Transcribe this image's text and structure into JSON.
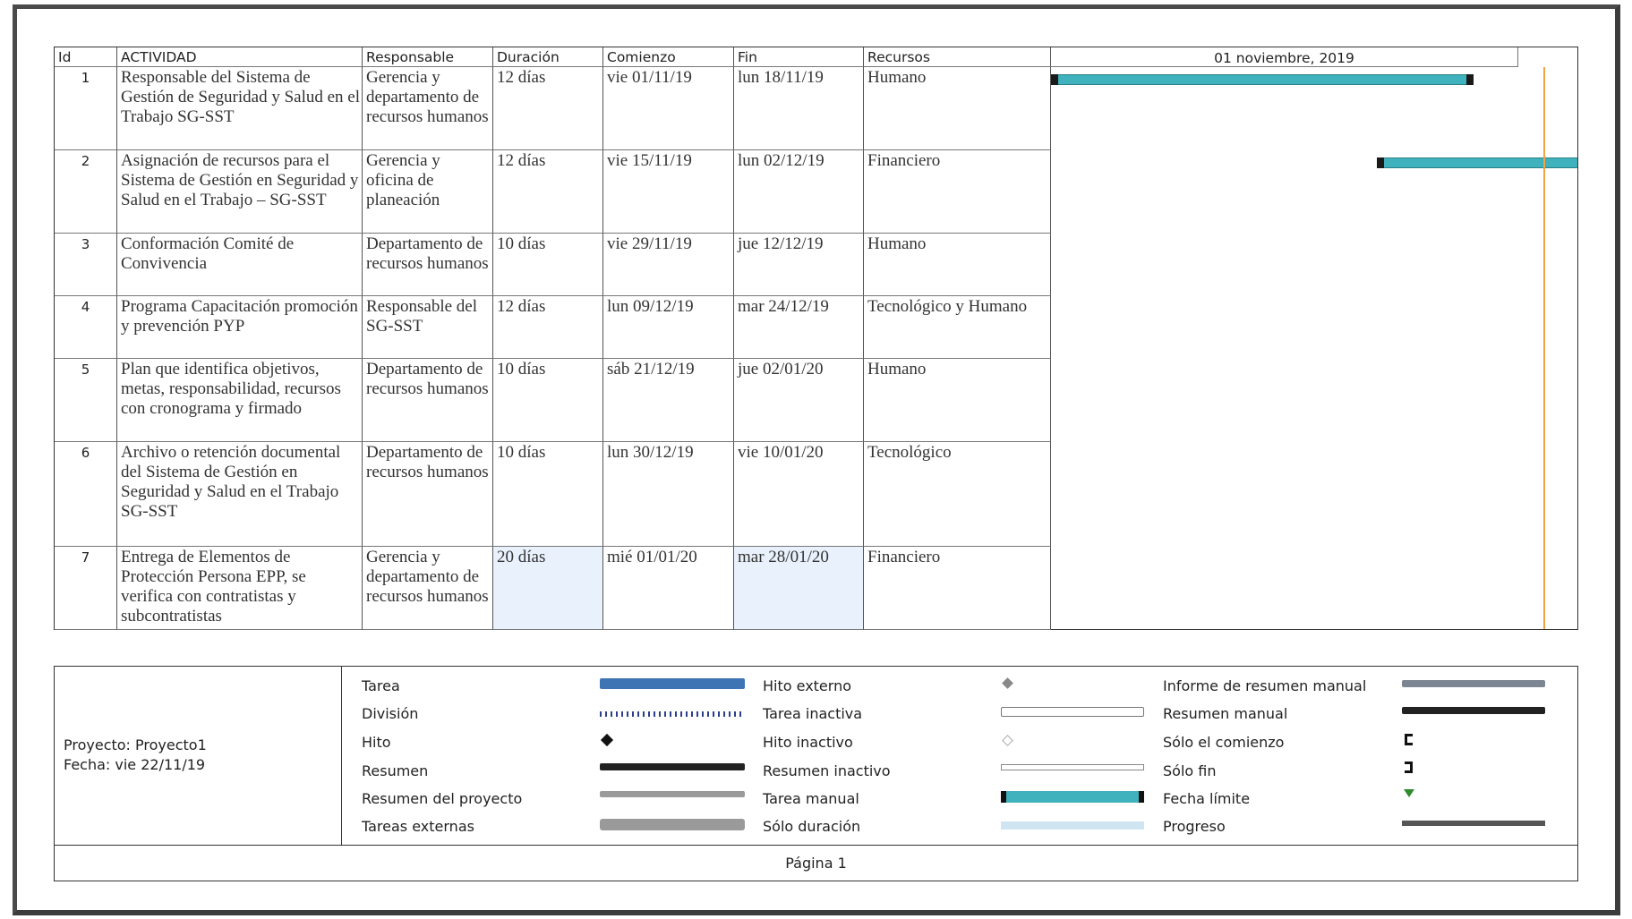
{
  "headers": {
    "id": "Id",
    "actividad": "ACTIVIDAD",
    "responsable": "Responsable",
    "duracion": "Duración",
    "comienzo": "Comienzo",
    "fin": "Fin",
    "recursos": "Recursos",
    "gantt_date": "01 noviembre, 2019"
  },
  "tasks": [
    {
      "id": "1",
      "actividad": "Responsable del Sistema de Gestión de Seguridad y Salud en el Trabajo SG-SST",
      "responsable": "Gerencia y departamento de recursos humanos",
      "duracion": "12 días",
      "comienzo": "vie 01/11/19",
      "fin": "lun 18/11/19",
      "recursos": "Humano"
    },
    {
      "id": "2",
      "actividad": "Asignación de recursos para el Sistema de Gestión en Seguridad y Salud en el Trabajo – SG-SST",
      "responsable": "Gerencia y oficina de planeación",
      "duracion": "12 días",
      "comienzo": "vie 15/11/19",
      "fin": "lun 02/12/19",
      "recursos": "Financiero"
    },
    {
      "id": "3",
      "actividad": "Conformación Comité de Convivencia",
      "responsable": "Departamento de recursos humanos",
      "duracion": "10 días",
      "comienzo": "vie 29/11/19",
      "fin": "jue 12/12/19",
      "recursos": "Humano"
    },
    {
      "id": "4",
      "actividad": "Programa Capacitación promoción y prevención PYP",
      "responsable": "Responsable del SG-SST",
      "duracion": "12 días",
      "comienzo": "lun 09/12/19",
      "fin": "mar 24/12/19",
      "recursos": "Tecnológico y Humano"
    },
    {
      "id": "5",
      "actividad": "Plan que identifica objetivos, metas, responsabilidad, recursos con cronograma y firmado",
      "responsable": "Departamento de recursos humanos",
      "duracion": "10 días",
      "comienzo": "sáb 21/12/19",
      "fin": "jue 02/01/20",
      "recursos": "Humano"
    },
    {
      "id": "6",
      "actividad": "Archivo o retención documental del Sistema de Gestión en Seguridad y Salud en el Trabajo SG-SST",
      "responsable": "Departamento de recursos humanos",
      "duracion": "10 días",
      "comienzo": "lun 30/12/19",
      "fin": "vie 10/01/20",
      "recursos": "Tecnológico"
    },
    {
      "id": "7",
      "actividad": "Entrega de Elementos de Protección Persona EPP, se verifica con contratistas y subcontratistas",
      "responsable": "Gerencia y departamento de recursos humanos",
      "duracion": "20 días",
      "comienzo": "mié 01/01/20",
      "fin": "mar 28/01/20",
      "recursos": "Financiero"
    }
  ],
  "project": {
    "name": "Proyecto: Proyecto1",
    "date": "Fecha: vie 22/11/19"
  },
  "legend": {
    "col1": [
      "Tarea",
      "División",
      "Hito",
      "Resumen",
      "Resumen del proyecto",
      "Tareas externas"
    ],
    "col2": [
      "Hito externo",
      "Tarea inactiva",
      "Hito inactivo",
      "Resumen inactivo",
      "Tarea manual",
      "Sólo duración"
    ],
    "col3": [
      "Informe de resumen manual",
      "Resumen manual",
      "Sólo el comienzo",
      "Sólo fin",
      "Fecha límite",
      "Progreso"
    ]
  },
  "footer": {
    "page": "Página 1"
  },
  "colors": {
    "manual_task": "#3fb2bd",
    "task": "#3f74b4",
    "deadline": "#f3a33f",
    "highlight": "#e9f1fc"
  }
}
